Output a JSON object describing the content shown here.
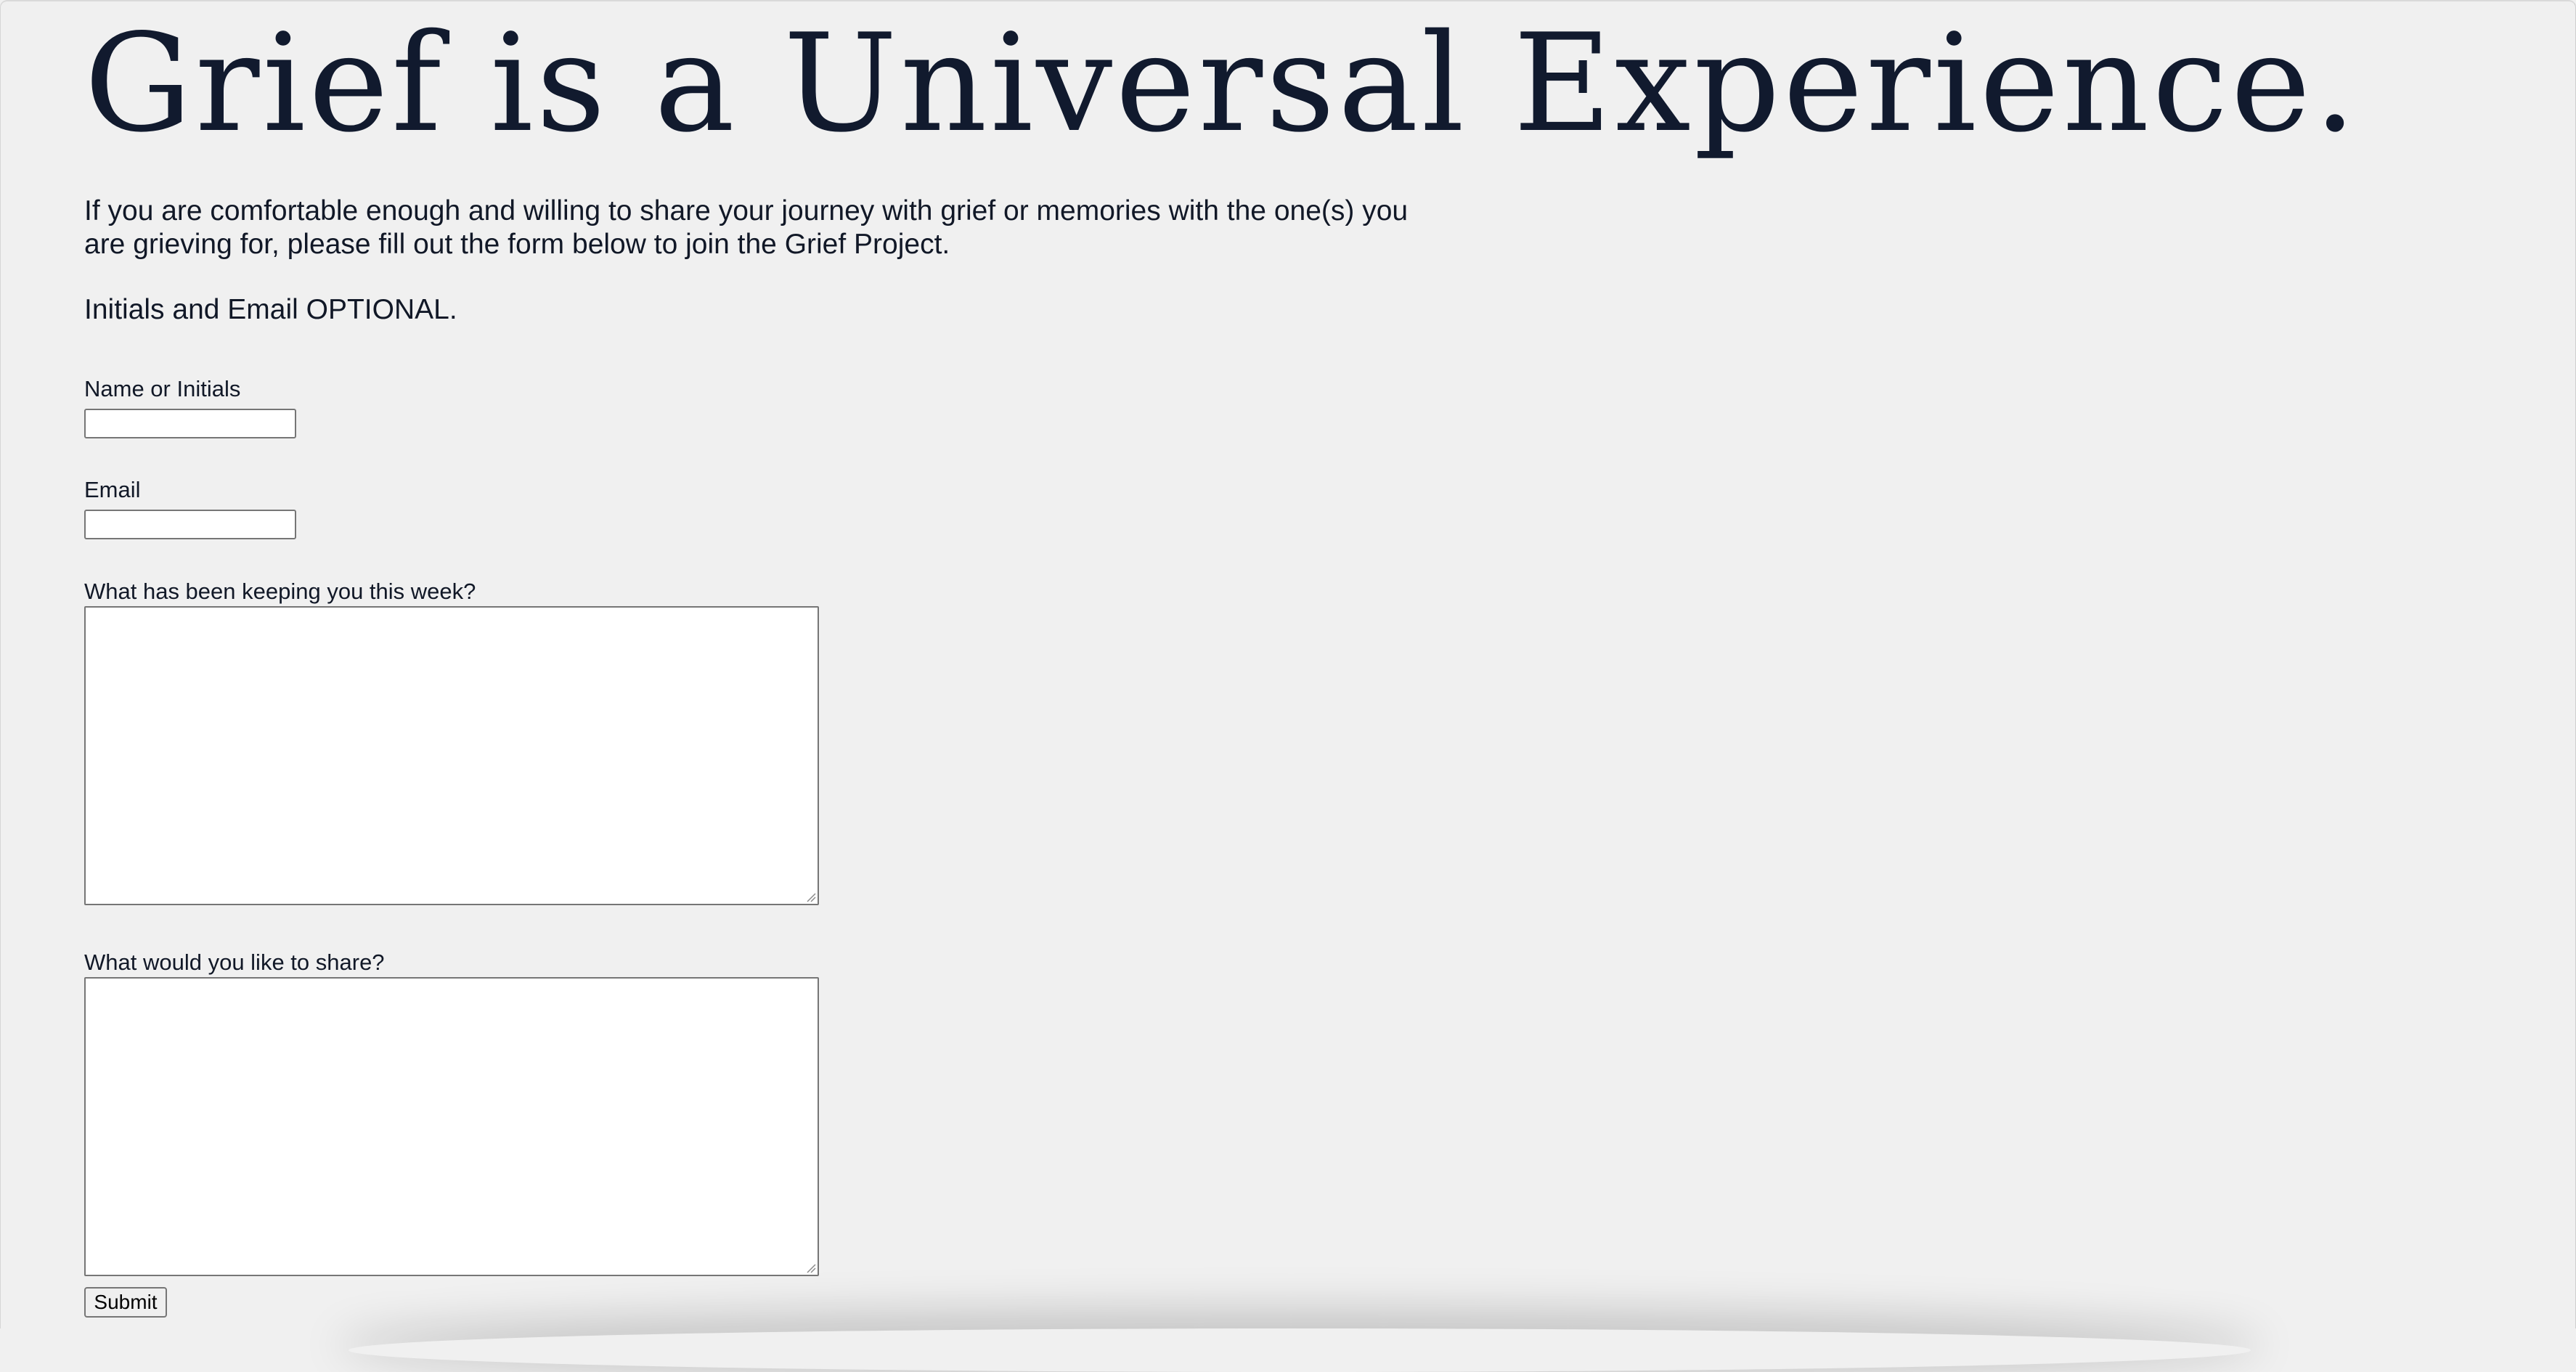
{
  "page": {
    "title": "Grief is a Universal Experience.",
    "intro": "If you are comfortable enough and willing to share your journey with grief or memories with the one(s) you are grieving for, please fill out the form below to join the Grief Project.",
    "optional_note": "Initials and Email OPTIONAL."
  },
  "form": {
    "name_label": "Name or Initials",
    "name_value": "",
    "email_label": "Email",
    "email_value": "",
    "week_label": "What has been keeping you this week?",
    "week_value": "",
    "share_label": "What would you like to share?",
    "share_value": "",
    "submit_label": "Submit"
  },
  "colors": {
    "background": "#f0f0f0",
    "heading": "#111a2e",
    "text": "#111827",
    "input_border": "#767676"
  },
  "icons": {
    "resize_grip": "textarea-resize-grip-icon"
  }
}
